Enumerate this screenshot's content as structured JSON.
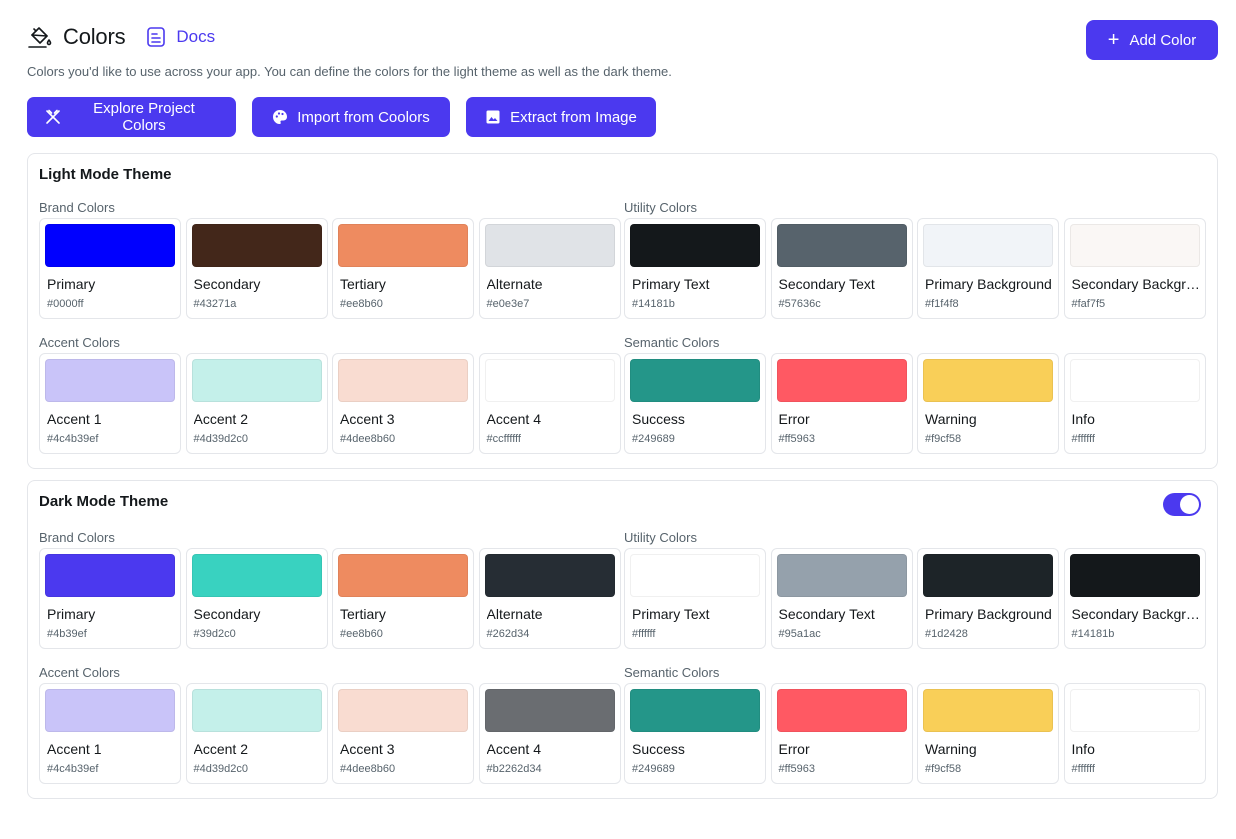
{
  "header": {
    "title": "Colors",
    "docs_label": "Docs",
    "add_color_label": "Add Color",
    "subtitle": "Colors you'd like to use across your app. You can define the colors for the light theme as well as the dark theme."
  },
  "actions": {
    "explore": "Explore Project Colors",
    "import": "Import from Coolors",
    "extract": "Extract from Image"
  },
  "accent_color": "#4b39ef",
  "light": {
    "title": "Light Mode Theme",
    "brand": {
      "label": "Brand Colors",
      "items": [
        {
          "name": "Primary",
          "hex": "#0000ff",
          "color": "#0000ff"
        },
        {
          "name": "Secondary",
          "hex": "#43271a",
          "color": "#43271a"
        },
        {
          "name": "Tertiary",
          "hex": "#ee8b60",
          "color": "#ee8b60"
        },
        {
          "name": "Alternate",
          "hex": "#e0e3e7",
          "color": "#e0e3e7"
        }
      ]
    },
    "utility": {
      "label": "Utility Colors",
      "items": [
        {
          "name": "Primary Text",
          "hex": "#14181b",
          "color": "#14181b"
        },
        {
          "name": "Secondary Text",
          "hex": "#57636c",
          "color": "#57636c"
        },
        {
          "name": "Primary Background",
          "hex": "#f1f4f8",
          "color": "#f1f4f8"
        },
        {
          "name": "Secondary Backgro...",
          "hex": "#faf7f5",
          "color": "#faf7f5"
        }
      ]
    },
    "accent": {
      "label": "Accent Colors",
      "items": [
        {
          "name": "Accent 1",
          "hex": "#4c4b39ef",
          "color": "#c9c4f9"
        },
        {
          "name": "Accent 2",
          "hex": "#4d39d2c0",
          "color": "#c4f0ea"
        },
        {
          "name": "Accent 3",
          "hex": "#4dee8b60",
          "color": "#f9dcd1"
        },
        {
          "name": "Accent 4",
          "hex": "#ccffffff",
          "color": "#ffffff"
        }
      ]
    },
    "semantic": {
      "label": "Semantic Colors",
      "items": [
        {
          "name": "Success",
          "hex": "#249689",
          "color": "#249689"
        },
        {
          "name": "Error",
          "hex": "#ff5963",
          "color": "#ff5963"
        },
        {
          "name": "Warning",
          "hex": "#f9cf58",
          "color": "#f9cf58"
        },
        {
          "name": "Info",
          "hex": "#ffffff",
          "color": "#ffffff"
        }
      ]
    }
  },
  "dark": {
    "title": "Dark Mode Theme",
    "enabled": true,
    "brand": {
      "label": "Brand Colors",
      "items": [
        {
          "name": "Primary",
          "hex": "#4b39ef",
          "color": "#4b39ef"
        },
        {
          "name": "Secondary",
          "hex": "#39d2c0",
          "color": "#39d2c0"
        },
        {
          "name": "Tertiary",
          "hex": "#ee8b60",
          "color": "#ee8b60"
        },
        {
          "name": "Alternate",
          "hex": "#262d34",
          "color": "#262d34"
        }
      ]
    },
    "utility": {
      "label": "Utility Colors",
      "items": [
        {
          "name": "Primary Text",
          "hex": "#ffffff",
          "color": "#ffffff"
        },
        {
          "name": "Secondary Text",
          "hex": "#95a1ac",
          "color": "#95a1ac"
        },
        {
          "name": "Primary Background",
          "hex": "#1d2428",
          "color": "#1d2428"
        },
        {
          "name": "Secondary Backgro...",
          "hex": "#14181b",
          "color": "#14181b"
        }
      ]
    },
    "accent": {
      "label": "Accent Colors",
      "items": [
        {
          "name": "Accent 1",
          "hex": "#4c4b39ef",
          "color": "#c9c4f9"
        },
        {
          "name": "Accent 2",
          "hex": "#4d39d2c0",
          "color": "#c4f0ea"
        },
        {
          "name": "Accent 3",
          "hex": "#4dee8b60",
          "color": "#f9dcd1"
        },
        {
          "name": "Accent 4",
          "hex": "#b2262d34",
          "color": "#6a6d71"
        }
      ]
    },
    "semantic": {
      "label": "Semantic Colors",
      "items": [
        {
          "name": "Success",
          "hex": "#249689",
          "color": "#249689"
        },
        {
          "name": "Error",
          "hex": "#ff5963",
          "color": "#ff5963"
        },
        {
          "name": "Warning",
          "hex": "#f9cf58",
          "color": "#f9cf58"
        },
        {
          "name": "Info",
          "hex": "#ffffff",
          "color": "#ffffff"
        }
      ]
    }
  }
}
